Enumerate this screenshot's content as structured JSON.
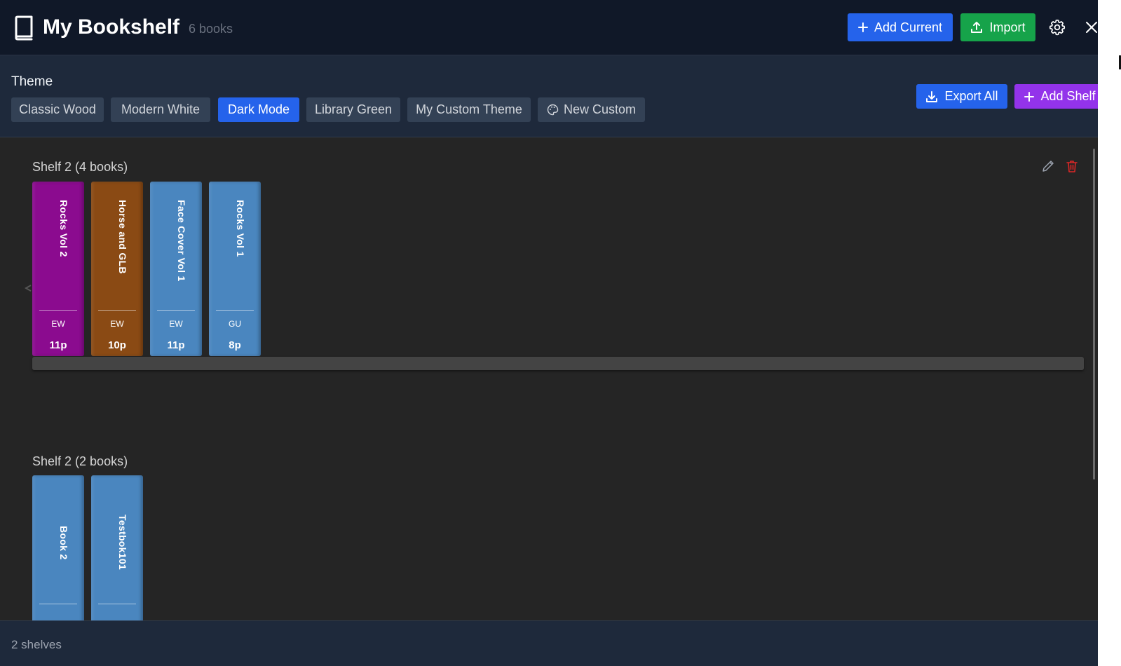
{
  "header": {
    "title": "My Bookshelf",
    "book_count": "6 books",
    "add_current_label": "Add Current",
    "import_label": "Import"
  },
  "theme": {
    "label": "Theme",
    "options": [
      {
        "label": "Classic Wood",
        "active": false
      },
      {
        "label": "Modern White",
        "active": false
      },
      {
        "label": "Dark Mode",
        "active": true
      },
      {
        "label": "Library Green",
        "active": false
      },
      {
        "label": "My Custom Theme",
        "active": false
      },
      {
        "label": "New Custom",
        "active": false,
        "icon": "palette-icon"
      }
    ],
    "export_label": "Export All",
    "add_shelf_label": "Add Shelf"
  },
  "shelves": [
    {
      "title": "Shelf 2 (4 books)",
      "books": [
        {
          "title": "Rocks Vol 2",
          "author": "EW",
          "pages": "11p",
          "color": "#8b0b8f"
        },
        {
          "title": "Horse and GLB",
          "author": "EW",
          "pages": "10p",
          "color": "#8a4a14"
        },
        {
          "title": "Face Cover Vol 1",
          "author": "EW",
          "pages": "11p",
          "color": "#4a86bf"
        },
        {
          "title": "Rocks Vol 1",
          "author": "GU",
          "pages": "8p",
          "color": "#4a86bf"
        }
      ]
    },
    {
      "title": "Shelf 2 (2 books)",
      "books": [
        {
          "title": "Book 2",
          "author": "",
          "pages": "",
          "color": "#4a86bf"
        },
        {
          "title": "Testbok101",
          "author": "",
          "pages": "",
          "color": "#4a86bf"
        }
      ]
    }
  ],
  "footer": {
    "shelf_count": "2 shelves"
  },
  "colors": {
    "header_bg": "#101828",
    "panel_bg": "#1e293b",
    "primary": "#2563eb",
    "success": "#16a34a",
    "purple": "#9333ea",
    "danger": "#dc2626",
    "shelf_board": "#444444"
  }
}
